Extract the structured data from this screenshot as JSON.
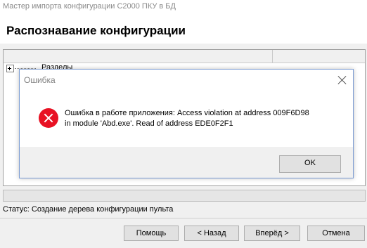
{
  "window": {
    "title": "Мастер импорта конфигурации С2000 ПКУ в БД",
    "page_title": "Распознавание конфигурации"
  },
  "tree": {
    "items": [
      {
        "label": "Разделы",
        "expander": "plus-expander-icon"
      }
    ]
  },
  "status": {
    "text": "Статус: Создание дерева конфигурации пульта"
  },
  "buttons": {
    "help": "Помощь",
    "back": "< Назад",
    "next": "Вперёд >",
    "cancel": "Отмена"
  },
  "dialog": {
    "title": "Ошибка",
    "icon": "error-icon",
    "message": "Ошибка в работе приложения: Access violation at address 009F6D98\nin module 'Abd.exe'. Read of address EDE0F2F1",
    "ok_label": "OK",
    "accent_color": "#e81123"
  }
}
